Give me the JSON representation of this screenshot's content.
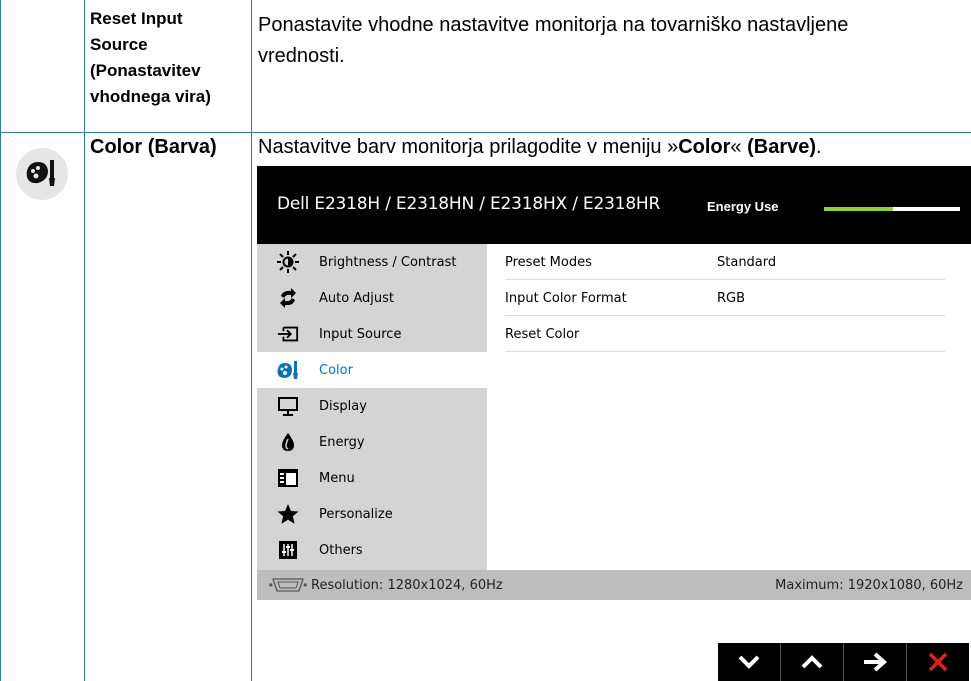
{
  "row1": {
    "label_lines": [
      "Reset Input",
      "Source",
      "(Ponastavitev",
      "vhodnega vira)"
    ],
    "description_lines": [
      "Ponastavite vhodne nastavitve monitorja na tovarniško nastavljene",
      "vrednosti."
    ]
  },
  "row2": {
    "icon": "color-palette-icon",
    "label": "Color (Barva)",
    "desc_prefix": "Nastavitve barv monitorja prilagodite v meniju »",
    "desc_bold1": "Color",
    "desc_mid": "« ",
    "desc_bold2": "(Barve)",
    "desc_suffix": "."
  },
  "osd": {
    "model": "Dell E2318H / E2318HN / E2318HX / E2318HR",
    "energy_label": "Energy Use",
    "energy_level": 0.51,
    "menu_items": [
      {
        "label": "Brightness / Contrast",
        "icon": "brightness-icon"
      },
      {
        "label": "Auto Adjust",
        "icon": "auto-adjust-icon"
      },
      {
        "label": "Input Source",
        "icon": "input-source-icon"
      },
      {
        "label": "Color",
        "icon": "color-icon",
        "active": true
      },
      {
        "label": "Display",
        "icon": "display-icon"
      },
      {
        "label": "Energy",
        "icon": "energy-icon"
      },
      {
        "label": "Menu",
        "icon": "menu-icon"
      },
      {
        "label": "Personalize",
        "icon": "star-icon"
      },
      {
        "label": "Others",
        "icon": "others-icon"
      }
    ],
    "settings": [
      {
        "name": "Preset Modes",
        "value": "Standard"
      },
      {
        "name": "Input Color Format",
        "value": "RGB"
      },
      {
        "name": "Reset Color",
        "value": ""
      }
    ],
    "footer": {
      "resolution": "Resolution: 1280x1024, 60Hz",
      "maximum": "Maximum: 1920x1080, 60Hz"
    }
  },
  "nav_buttons": [
    {
      "name": "down-button",
      "icon": "chevron-down-icon"
    },
    {
      "name": "up-button",
      "icon": "chevron-up-icon"
    },
    {
      "name": "next-button",
      "icon": "arrow-right-icon"
    },
    {
      "name": "exit-button",
      "icon": "close-icon"
    }
  ],
  "colors": {
    "accent": "#0a73b6",
    "energy_fill": "#8fd13d",
    "exit": "#e02020",
    "grid": "#2f7f8f"
  }
}
